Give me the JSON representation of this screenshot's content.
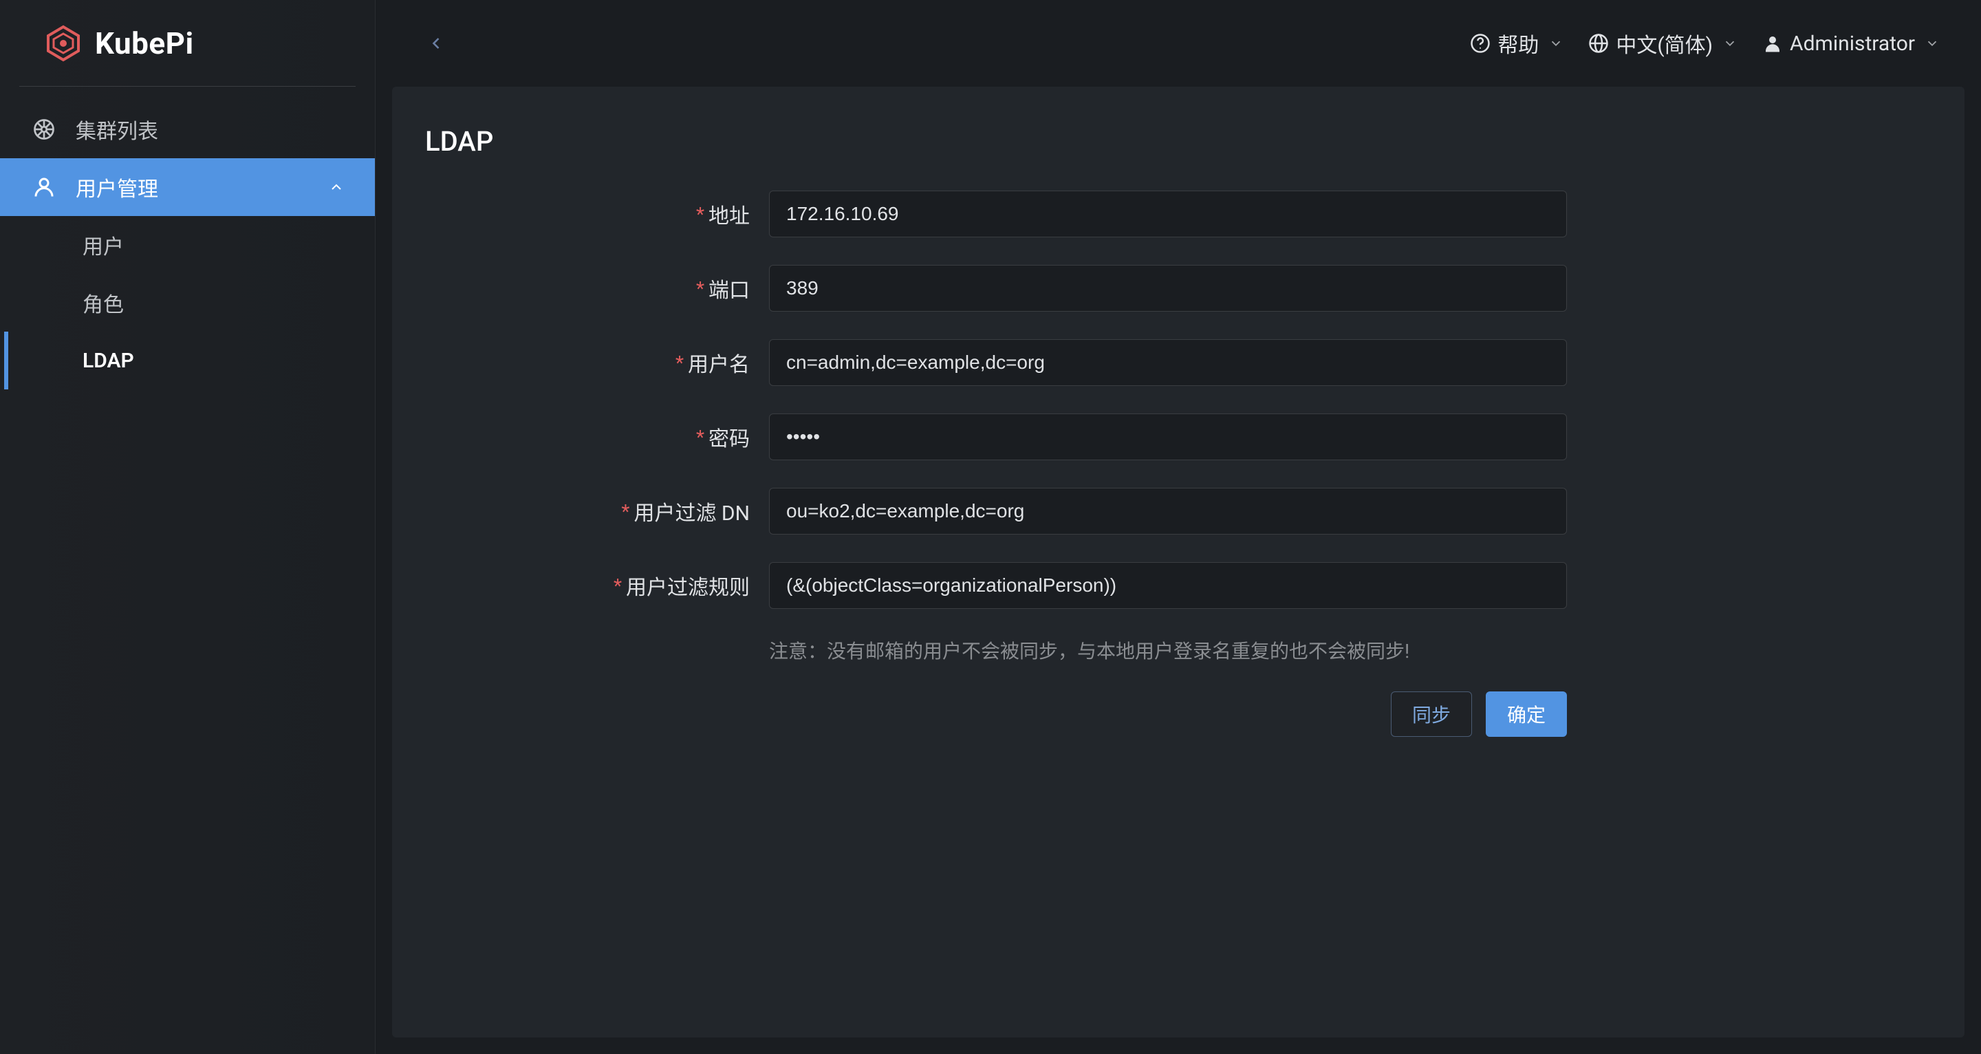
{
  "brand": {
    "name": "KubePi"
  },
  "sidebar": {
    "items": [
      {
        "id": "clusters",
        "label": "集群列表"
      },
      {
        "id": "user-mgmt",
        "label": "用户管理"
      }
    ],
    "sub_items": [
      {
        "id": "users",
        "label": "用户"
      },
      {
        "id": "roles",
        "label": "角色"
      },
      {
        "id": "ldap",
        "label": "LDAP"
      }
    ]
  },
  "topbar": {
    "help": "帮助",
    "language": "中文(简体)",
    "user": "Administrator"
  },
  "page": {
    "title": "LDAP",
    "form": {
      "address": {
        "label": "地址",
        "value": "172.16.10.69"
      },
      "port": {
        "label": "端口",
        "value": "389"
      },
      "username": {
        "label": "用户名",
        "value": "cn=admin,dc=example,dc=org"
      },
      "password": {
        "label": "密码",
        "value": "•••••"
      },
      "filter_dn": {
        "label": "用户过滤 DN",
        "value": "ou=ko2,dc=example,dc=org"
      },
      "filter_rule": {
        "label": "用户过滤规则",
        "value": "(&(objectClass=organizationalPerson))"
      }
    },
    "note": "注意：没有邮箱的用户不会被同步，与本地用户登录名重复的也不会被同步!",
    "actions": {
      "sync": "同步",
      "confirm": "确定"
    }
  }
}
